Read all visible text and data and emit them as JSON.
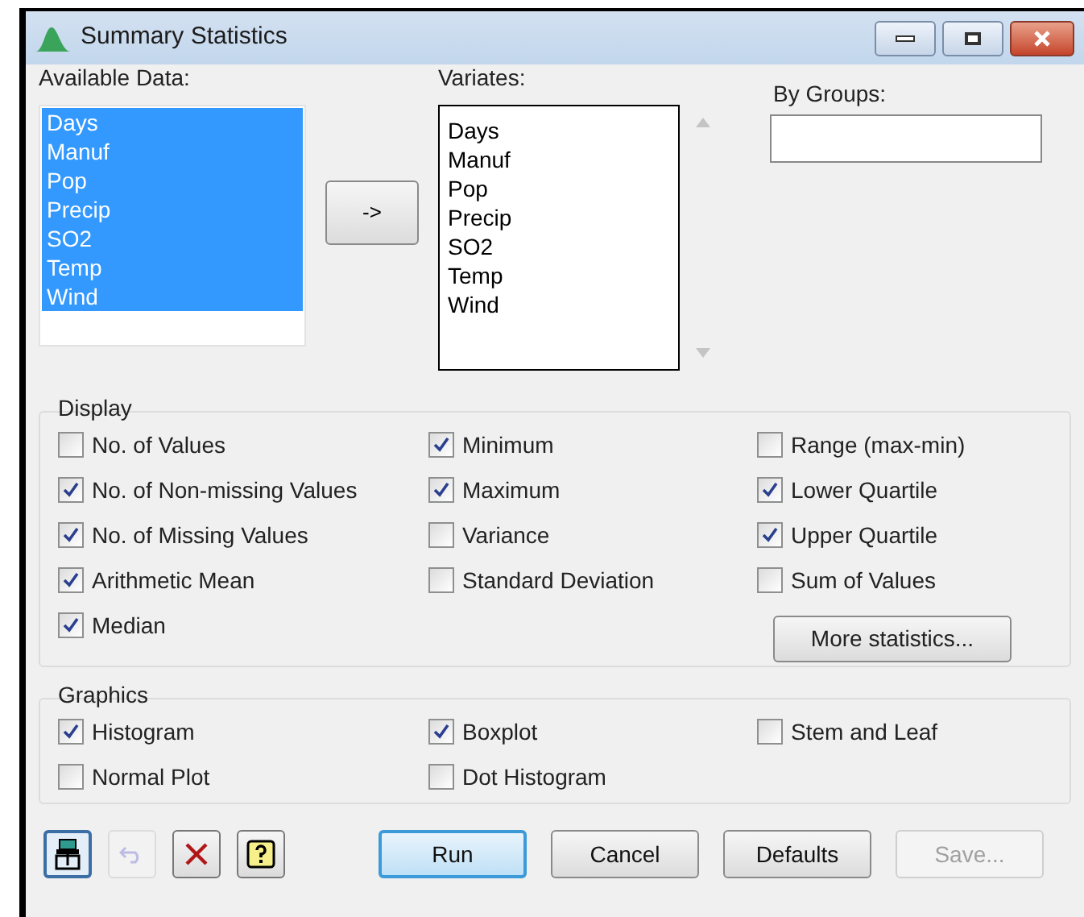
{
  "window": {
    "title": "Summary Statistics"
  },
  "available_data": {
    "label": "Available Data:",
    "items": [
      {
        "text": "Days",
        "selected": true
      },
      {
        "text": "Manuf",
        "selected": true
      },
      {
        "text": "Pop",
        "selected": true
      },
      {
        "text": "Precip",
        "selected": true
      },
      {
        "text": "SO2",
        "selected": true
      },
      {
        "text": "Temp",
        "selected": true
      },
      {
        "text": "Wind",
        "selected": true
      }
    ]
  },
  "move_button": {
    "label": "->"
  },
  "variates": {
    "label": "Variates:",
    "items": [
      "Days",
      "Manuf",
      "Pop",
      "Precip",
      "SO2",
      "Temp",
      "Wind"
    ]
  },
  "by_groups": {
    "label": "By Groups:"
  },
  "display": {
    "title": "Display",
    "columns": [
      [
        {
          "label": "No. of Values",
          "checked": false
        },
        {
          "label": "No. of Non-missing Values",
          "checked": true
        },
        {
          "label": "No. of Missing Values",
          "checked": true
        },
        {
          "label": "Arithmetic Mean",
          "checked": true
        },
        {
          "label": "Median",
          "checked": true
        }
      ],
      [
        {
          "label": "Minimum",
          "checked": true
        },
        {
          "label": "Maximum",
          "checked": true
        },
        {
          "label": "Variance",
          "checked": false
        },
        {
          "label": "Standard Deviation",
          "checked": false
        }
      ],
      [
        {
          "label": "Range (max-min)",
          "checked": false
        },
        {
          "label": "Lower Quartile",
          "checked": true
        },
        {
          "label": "Upper Quartile",
          "checked": true
        },
        {
          "label": "Sum of Values",
          "checked": false
        }
      ]
    ],
    "more_button": "More statistics..."
  },
  "graphics": {
    "title": "Graphics",
    "columns": [
      [
        {
          "label": "Histogram",
          "checked": true
        },
        {
          "label": "Normal Plot",
          "checked": false
        }
      ],
      [
        {
          "label": "Boxplot",
          "checked": true
        },
        {
          "label": "Dot Histogram",
          "checked": false
        }
      ],
      [
        {
          "label": "Stem and Leaf",
          "checked": false
        }
      ]
    ]
  },
  "tool_buttons": [
    {
      "kind": "pin",
      "pressed": true,
      "disabled": false
    },
    {
      "kind": "undo",
      "pressed": false,
      "disabled": true
    },
    {
      "kind": "clear",
      "pressed": false,
      "disabled": false
    },
    {
      "kind": "help",
      "pressed": false,
      "disabled": false
    }
  ],
  "buttons": [
    {
      "label": "Run",
      "default": true,
      "disabled": false
    },
    {
      "label": "Cancel",
      "default": false,
      "disabled": false
    },
    {
      "label": "Defaults",
      "default": false,
      "disabled": false
    },
    {
      "label": "Save...",
      "default": false,
      "disabled": true
    }
  ]
}
